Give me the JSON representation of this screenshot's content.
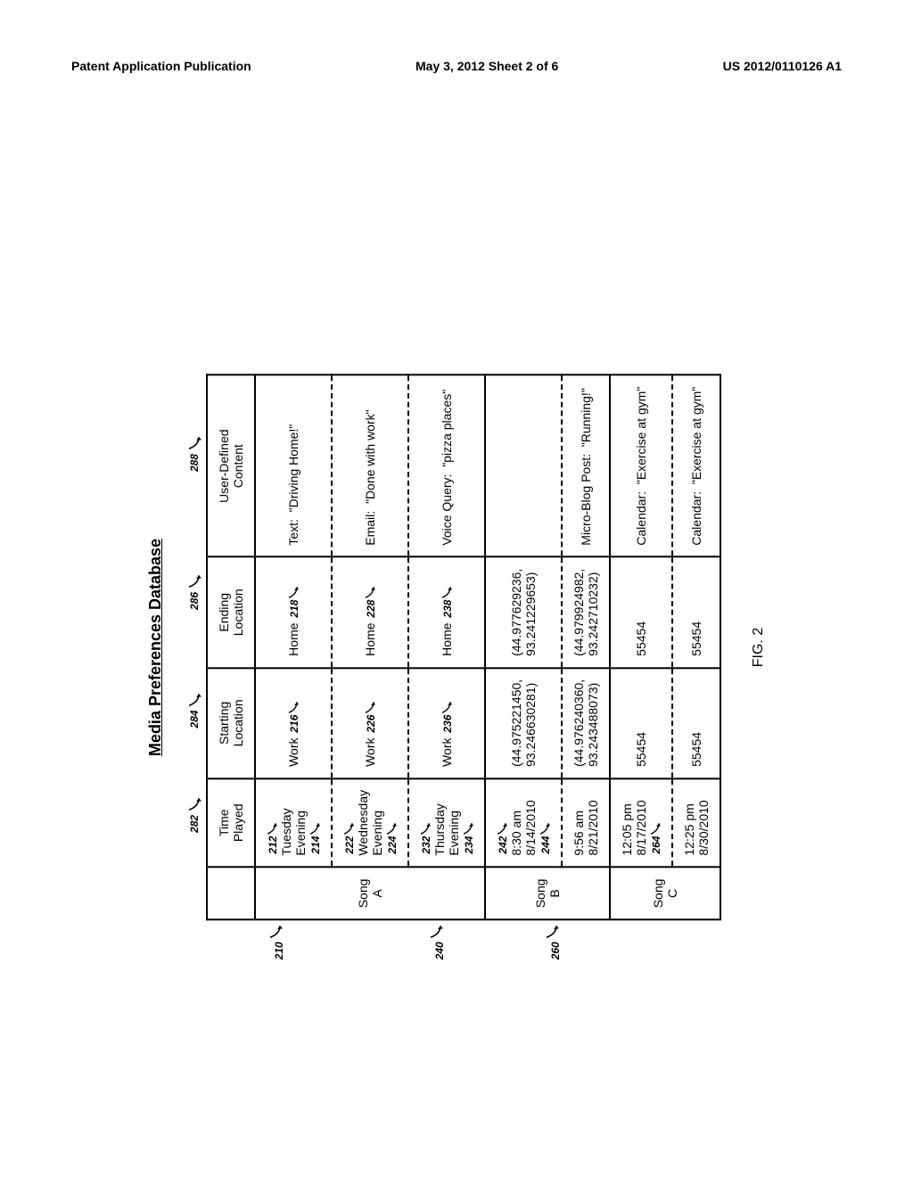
{
  "header": {
    "left": "Patent Application Publication",
    "center": "May 3, 2012   Sheet 2 of 6",
    "right": "US 2012/0110126 A1"
  },
  "title": "Media Preferences Database",
  "figure_caption": "FIG. 2",
  "col_callouts": {
    "time": "282",
    "start": "284",
    "end": "286",
    "udc": "288"
  },
  "columns": {
    "blank": "",
    "time": "Time\nPlayed",
    "start": "Starting\nLocation",
    "end": "Ending\nLocation",
    "udc": "User-Defined\nContent"
  },
  "groups": [
    {
      "callout": "210",
      "song": "Song A",
      "rows": [
        {
          "row_callout": "212",
          "time": "Tuesday\nEvening",
          "time_callout": "214",
          "start": "Work",
          "start_callout": "216",
          "end": "Home",
          "end_callout": "218",
          "udc": "Text:  \"Driving Home!\""
        },
        {
          "row_callout": "222",
          "time": "Wednesday\nEvening",
          "time_callout": "224",
          "start": "Work",
          "start_callout": "226",
          "end": "Home",
          "end_callout": "228",
          "udc": "Email:  \"Done with work\""
        },
        {
          "row_callout": "232",
          "time": "Thursday\nEvening",
          "time_callout": "234",
          "start": "Work",
          "start_callout": "236",
          "end": "Home",
          "end_callout": "238",
          "udc": "Voice Query:  \"pizza places\""
        }
      ]
    },
    {
      "callout": "240",
      "song": "Song B",
      "rows": [
        {
          "row_callout": "242",
          "time": "8:30 am\n8/14/2010",
          "time_callout": "244",
          "start": "(44.975221450,\n93.246630281)",
          "start_callout": "",
          "end": "(44.977629236,\n93.241229653)",
          "end_callout": "",
          "udc": ""
        },
        {
          "row_callout": "",
          "time": "9:56 am\n8/21/2010",
          "time_callout": "",
          "start": "(44.976240360,\n93.243488073)",
          "start_callout": "",
          "end": "(44.979924982,\n93.242710232)",
          "end_callout": "",
          "udc": "Micro-Blog Post:  \"Running!\""
        }
      ]
    },
    {
      "callout": "260",
      "song": "Song C",
      "rows": [
        {
          "row_callout": "",
          "time": "12:05 pm\n8/17/2010",
          "time_callout": "264",
          "start": "55454",
          "start_callout": "",
          "end": "55454",
          "end_callout": "",
          "udc": "Calendar:  \"Exercise at gym\""
        },
        {
          "row_callout": "",
          "time": "12:25 pm\n8/30/2010",
          "time_callout": "",
          "start": "55454",
          "start_callout": "",
          "end": "55454",
          "end_callout": "",
          "udc": "Calendar:  \"Exercise at gym\""
        }
      ]
    }
  ]
}
